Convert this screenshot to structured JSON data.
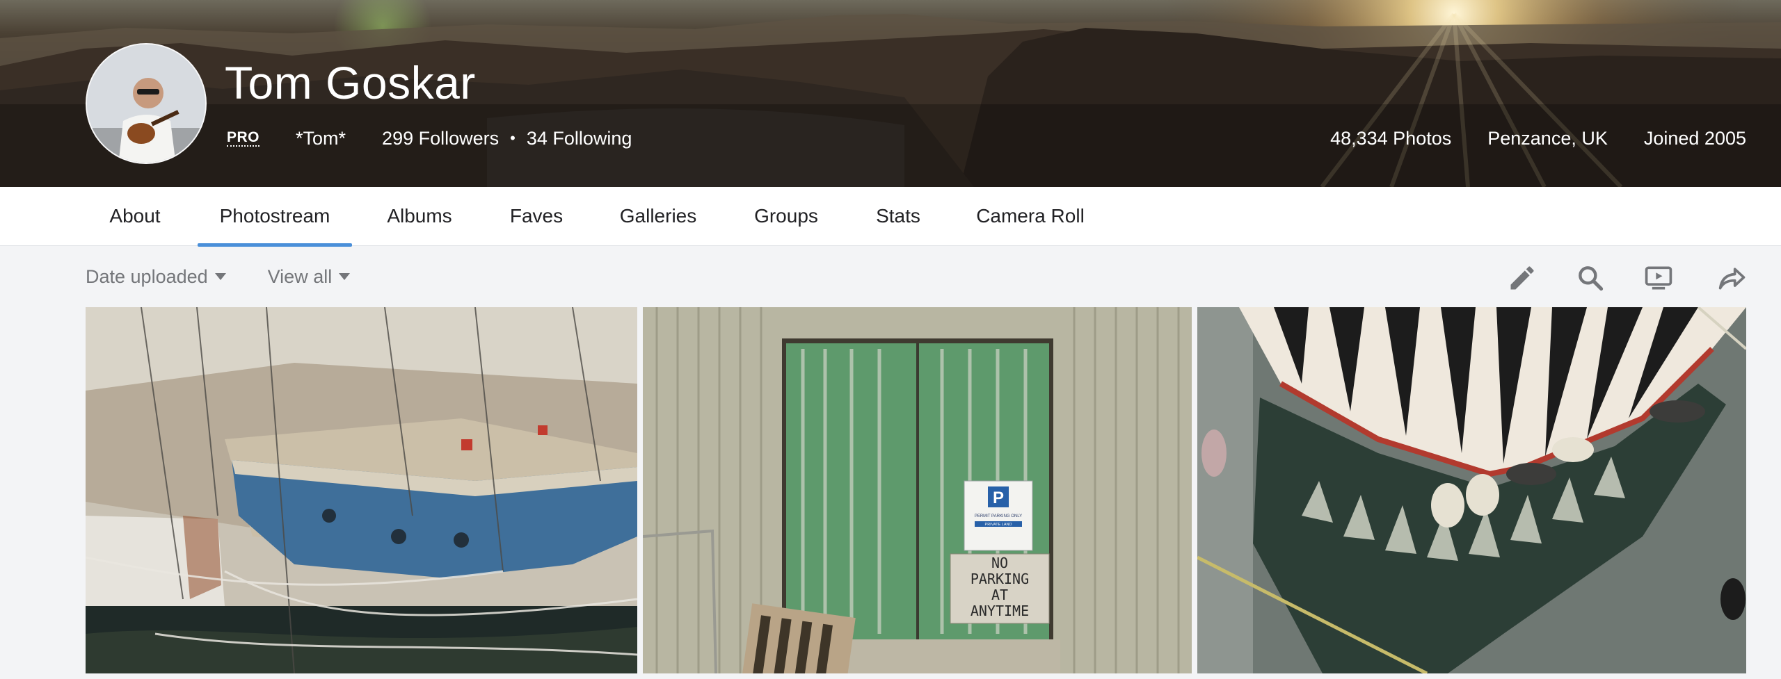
{
  "profile": {
    "name": "Tom Goskar",
    "badge": "PRO",
    "real_name": "*Tom*",
    "followers": "299 Followers",
    "following": "34 Following",
    "separator": "•",
    "photos": "48,334 Photos",
    "location": "Penzance, UK",
    "joined": "Joined 2005"
  },
  "tabs": [
    {
      "label": "About",
      "active": false
    },
    {
      "label": "Photostream",
      "active": true
    },
    {
      "label": "Albums",
      "active": false
    },
    {
      "label": "Faves",
      "active": false
    },
    {
      "label": "Galleries",
      "active": false
    },
    {
      "label": "Groups",
      "active": false
    },
    {
      "label": "Stats",
      "active": false
    },
    {
      "label": "Camera Roll",
      "active": false
    }
  ],
  "toolbar": {
    "sort_label": "Date uploaded",
    "view_label": "View all",
    "icons": [
      "pencil-icon",
      "search-icon",
      "slideshow-icon",
      "share-icon"
    ]
  },
  "photos": {
    "photo2_sign_text": "PERMIT PARKING ONLY",
    "photo2_sign_sub": "PRIVATE LAND",
    "photo2_painted_text": [
      "NO",
      "PARKING",
      "AT",
      "ANYTIME"
    ]
  },
  "colors": {
    "accent": "#4a8fd9",
    "icon_gray": "#74767a",
    "page_bg": "#f3f4f6"
  }
}
